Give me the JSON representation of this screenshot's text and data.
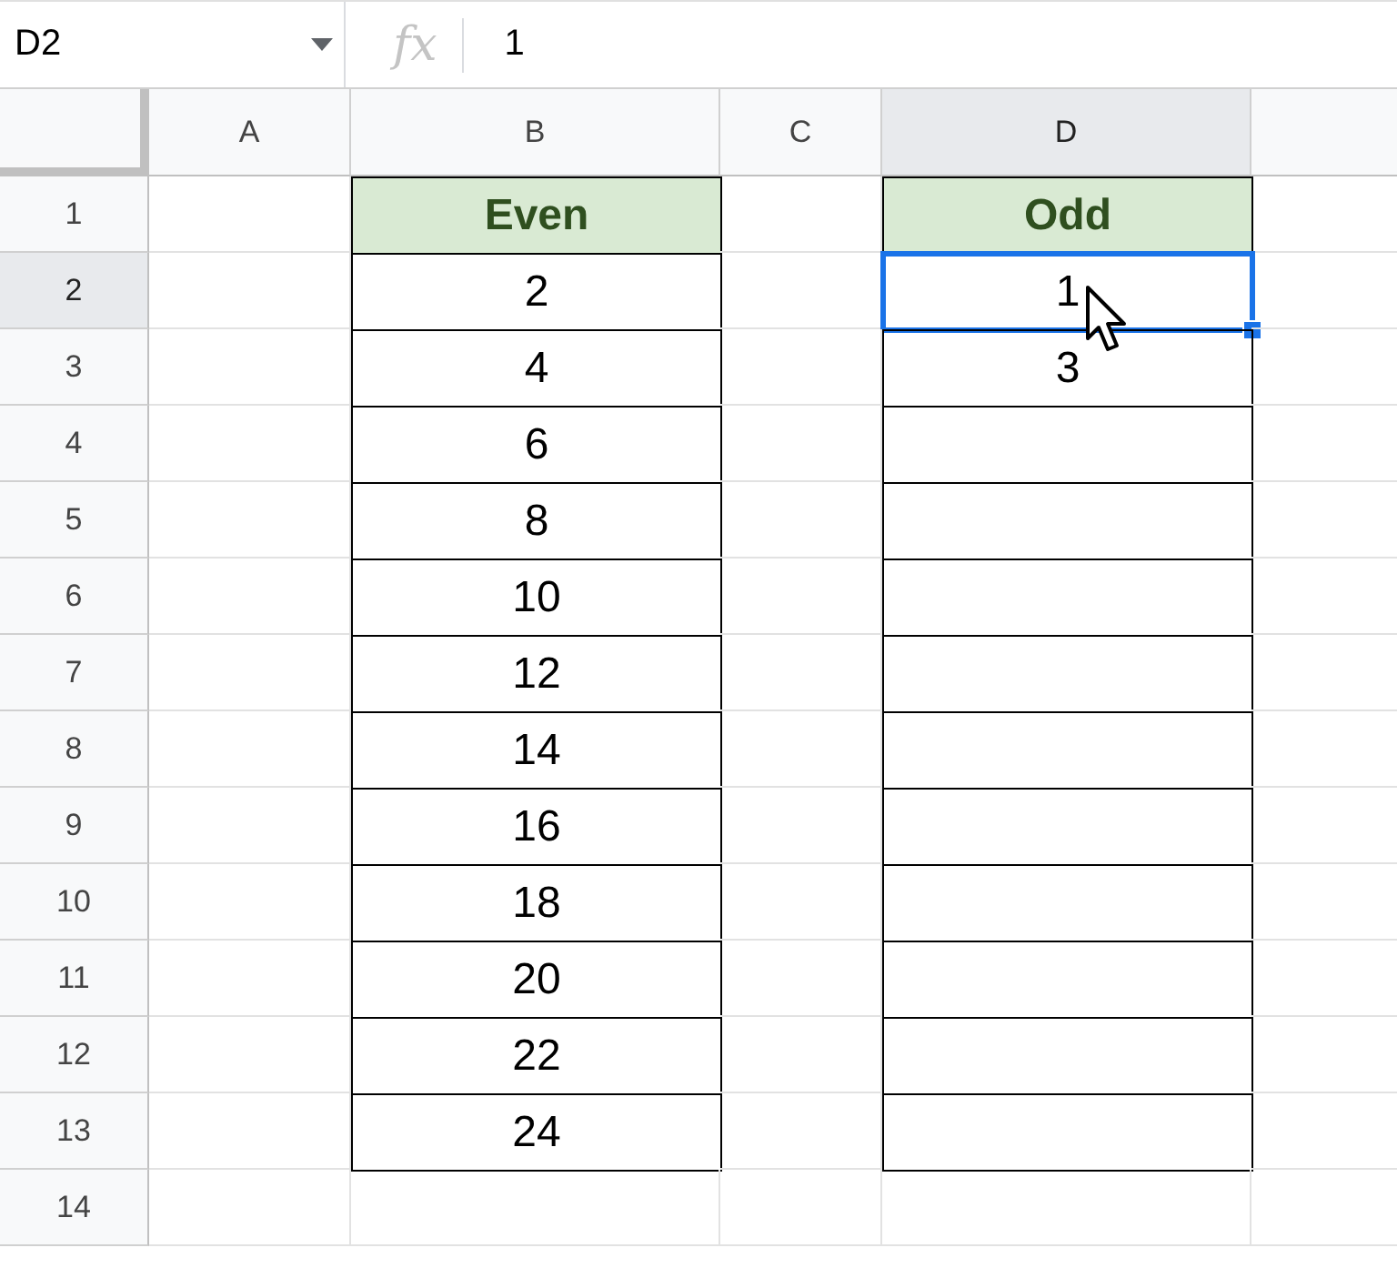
{
  "formula_bar": {
    "name_box": "D2",
    "function_label": "fx",
    "formula": "1"
  },
  "columns": [
    {
      "label": "A",
      "selected": false
    },
    {
      "label": "B",
      "selected": false
    },
    {
      "label": "C",
      "selected": false
    },
    {
      "label": "D",
      "selected": true
    }
  ],
  "rows": [
    {
      "number": "1",
      "selected": false,
      "cells": [
        {
          "selected": false,
          "bordered": false
        },
        {
          "text": "Even",
          "kind": "header",
          "selected": false,
          "bordered": true
        },
        {
          "selected": false,
          "bordered": false
        },
        {
          "text": "Odd",
          "kind": "header",
          "selected": false,
          "bordered": true
        }
      ]
    },
    {
      "number": "2",
      "selected": true,
      "cells": [
        {
          "selected": false,
          "bordered": false
        },
        {
          "text": "2",
          "kind": "value",
          "selected": false,
          "bordered": true
        },
        {
          "selected": false,
          "bordered": false
        },
        {
          "text": "1",
          "kind": "value",
          "selected": true,
          "bordered": true
        }
      ]
    },
    {
      "number": "3",
      "selected": false,
      "cells": [
        {
          "selected": false,
          "bordered": false
        },
        {
          "text": "4",
          "kind": "value",
          "selected": false,
          "bordered": true
        },
        {
          "selected": false,
          "bordered": false
        },
        {
          "text": "3",
          "kind": "value",
          "selected": false,
          "bordered": true
        }
      ]
    },
    {
      "number": "4",
      "selected": false,
      "cells": [
        {
          "selected": false,
          "bordered": false
        },
        {
          "text": "6",
          "kind": "value",
          "selected": false,
          "bordered": true
        },
        {
          "selected": false,
          "bordered": false
        },
        {
          "selected": false,
          "bordered": true
        }
      ]
    },
    {
      "number": "5",
      "selected": false,
      "cells": [
        {
          "selected": false,
          "bordered": false
        },
        {
          "text": "8",
          "kind": "value",
          "selected": false,
          "bordered": true
        },
        {
          "selected": false,
          "bordered": false
        },
        {
          "selected": false,
          "bordered": true
        }
      ]
    },
    {
      "number": "6",
      "selected": false,
      "cells": [
        {
          "selected": false,
          "bordered": false
        },
        {
          "text": "10",
          "kind": "value",
          "selected": false,
          "bordered": true
        },
        {
          "selected": false,
          "bordered": false
        },
        {
          "selected": false,
          "bordered": true
        }
      ]
    },
    {
      "number": "7",
      "selected": false,
      "cells": [
        {
          "selected": false,
          "bordered": false
        },
        {
          "text": "12",
          "kind": "value",
          "selected": false,
          "bordered": true
        },
        {
          "selected": false,
          "bordered": false
        },
        {
          "selected": false,
          "bordered": true
        }
      ]
    },
    {
      "number": "8",
      "selected": false,
      "cells": [
        {
          "selected": false,
          "bordered": false
        },
        {
          "text": "14",
          "kind": "value",
          "selected": false,
          "bordered": true
        },
        {
          "selected": false,
          "bordered": false
        },
        {
          "selected": false,
          "bordered": true
        }
      ]
    },
    {
      "number": "9",
      "selected": false,
      "cells": [
        {
          "selected": false,
          "bordered": false
        },
        {
          "text": "16",
          "kind": "value",
          "selected": false,
          "bordered": true
        },
        {
          "selected": false,
          "bordered": false
        },
        {
          "selected": false,
          "bordered": true
        }
      ]
    },
    {
      "number": "10",
      "selected": false,
      "cells": [
        {
          "selected": false,
          "bordered": false
        },
        {
          "text": "18",
          "kind": "value",
          "selected": false,
          "bordered": true
        },
        {
          "selected": false,
          "bordered": false
        },
        {
          "selected": false,
          "bordered": true
        }
      ]
    },
    {
      "number": "11",
      "selected": false,
      "cells": [
        {
          "selected": false,
          "bordered": false
        },
        {
          "text": "20",
          "kind": "value",
          "selected": false,
          "bordered": true
        },
        {
          "selected": false,
          "bordered": false
        },
        {
          "selected": false,
          "bordered": true
        }
      ]
    },
    {
      "number": "12",
      "selected": false,
      "cells": [
        {
          "selected": false,
          "bordered": false
        },
        {
          "text": "22",
          "kind": "value",
          "selected": false,
          "bordered": true
        },
        {
          "selected": false,
          "bordered": false
        },
        {
          "selected": false,
          "bordered": true
        }
      ]
    },
    {
      "number": "13",
      "selected": false,
      "cells": [
        {
          "selected": false,
          "bordered": false
        },
        {
          "text": "24",
          "kind": "value",
          "selected": false,
          "bordered": true
        },
        {
          "selected": false,
          "bordered": false
        },
        {
          "selected": false,
          "bordered": true
        }
      ]
    },
    {
      "number": "14",
      "selected": false,
      "cells": [
        {
          "selected": false,
          "bordered": false
        },
        {
          "selected": false,
          "bordered": false
        },
        {
          "selected": false,
          "bordered": false
        },
        {
          "selected": false,
          "bordered": false
        }
      ]
    }
  ]
}
